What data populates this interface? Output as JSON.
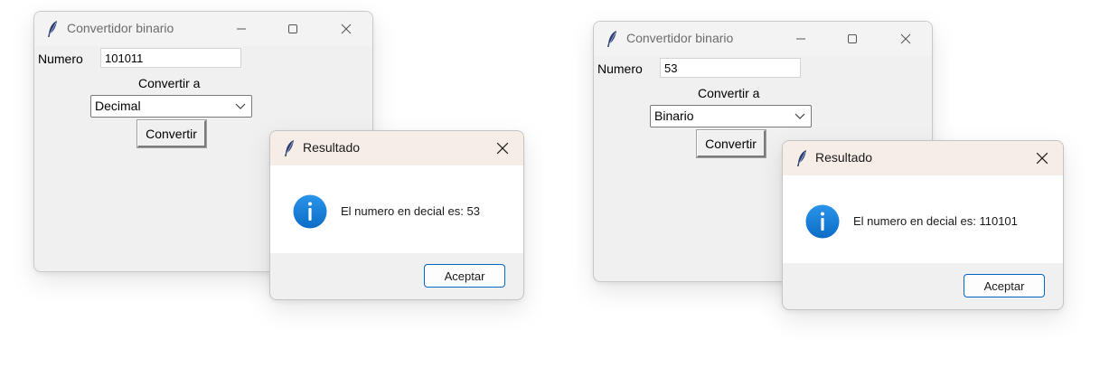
{
  "left": {
    "main": {
      "title": "Convertidor binario",
      "numero_label": "Numero",
      "numero_value": "101011",
      "convertir_a_label": "Convertir a",
      "conversion_option": "Decimal",
      "convertir_button": "Convertir"
    },
    "dialog": {
      "title": "Resultado",
      "message": "El numero en decial es: 53",
      "accept_button": "Aceptar"
    }
  },
  "right": {
    "main": {
      "title": "Convertidor binario",
      "numero_label": "Numero",
      "numero_value": "53",
      "convertir_a_label": "Convertir a",
      "conversion_option": "Binario",
      "convertir_button": "Convertir"
    },
    "dialog": {
      "title": "Resultado",
      "message": "El numero en decial es: 110101",
      "accept_button": "Aceptar"
    }
  },
  "icons": {
    "app": "feather-icon",
    "minimize": "minimize-icon",
    "maximize": "maximize-icon",
    "close": "close-icon",
    "info": "info-icon",
    "dropdown": "chevron-down-icon"
  },
  "colors": {
    "window_bg": "#f0f0f0",
    "dialog_titlebar": "#f7ede7",
    "accent": "#0067c0",
    "info_icon": "#1a7fd9"
  }
}
